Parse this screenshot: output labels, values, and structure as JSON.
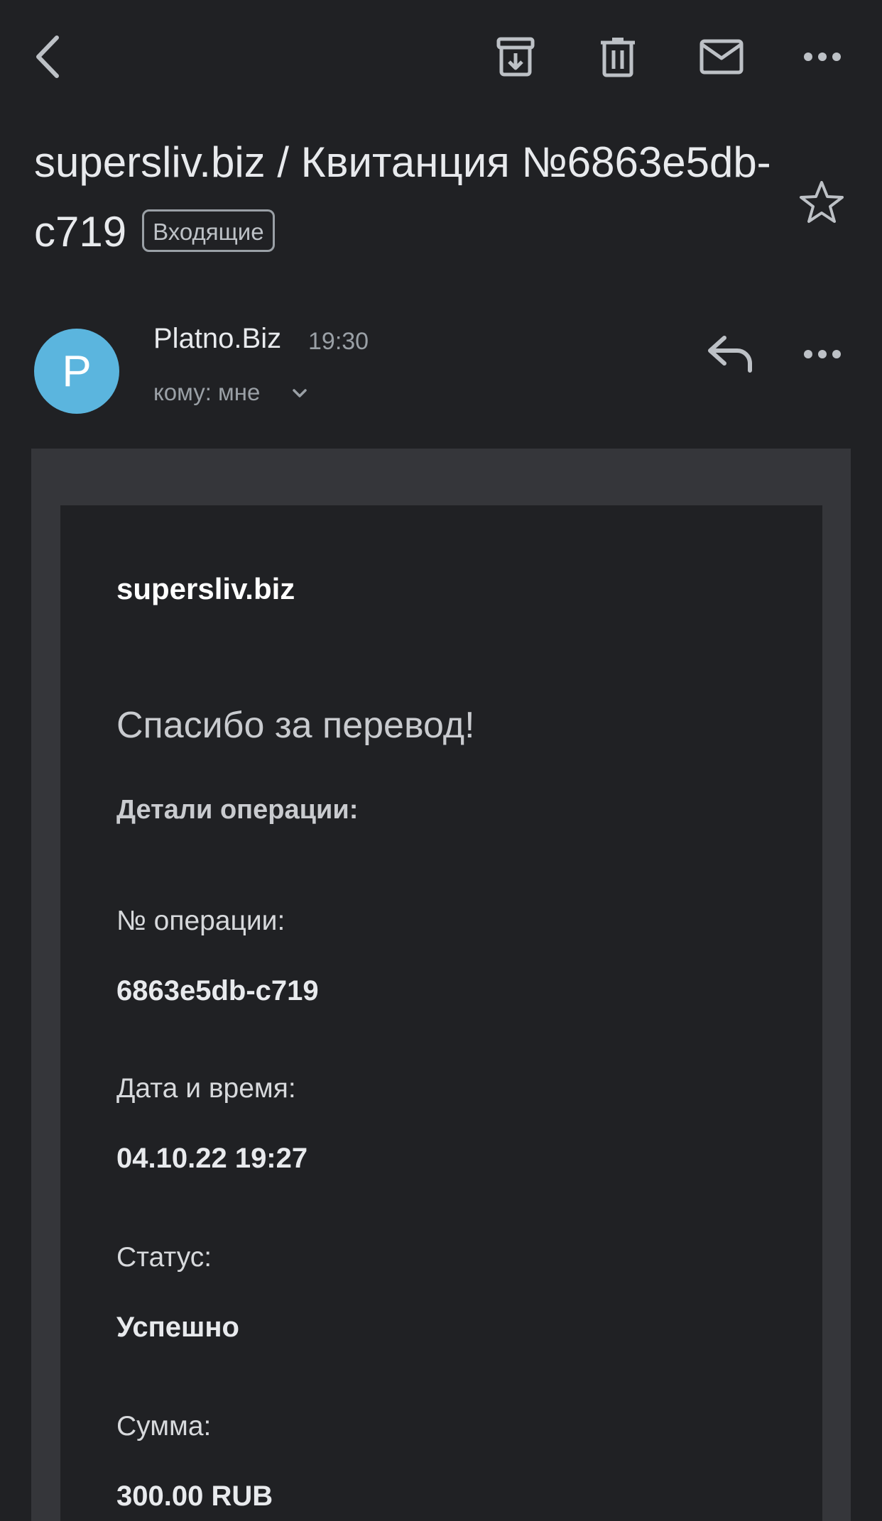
{
  "toolbar": {
    "icons": [
      "back-arrow-icon",
      "archive-icon",
      "trash-icon",
      "mail-icon",
      "more-vert-icon"
    ]
  },
  "email": {
    "subject": "supersliv.biz / Квитанция №6863e5db-c719",
    "label": "Входящие",
    "sender": "Platno.Biz",
    "sender_initial": "P",
    "time": "19:30",
    "recipient": "кому: мне",
    "avatar_color": "#5bb5de"
  },
  "body": {
    "brand": "supersliv.biz",
    "thanks": "Спасибо за перевод!",
    "details_heading": "Детали операции:",
    "fields": [
      {
        "label": "№ операции:",
        "value": "6863e5db-c719"
      },
      {
        "label": "Дата и время:",
        "value": "04.10.22 19:27"
      },
      {
        "label": "Статус:",
        "value": "Успешно"
      },
      {
        "label": "Сумма:",
        "value": "300.00 RUB"
      }
    ]
  },
  "colors": {
    "background": "#202124",
    "frame": "#35363a",
    "text": "#e8eaed",
    "secondary_text": "#9aa0a6"
  }
}
